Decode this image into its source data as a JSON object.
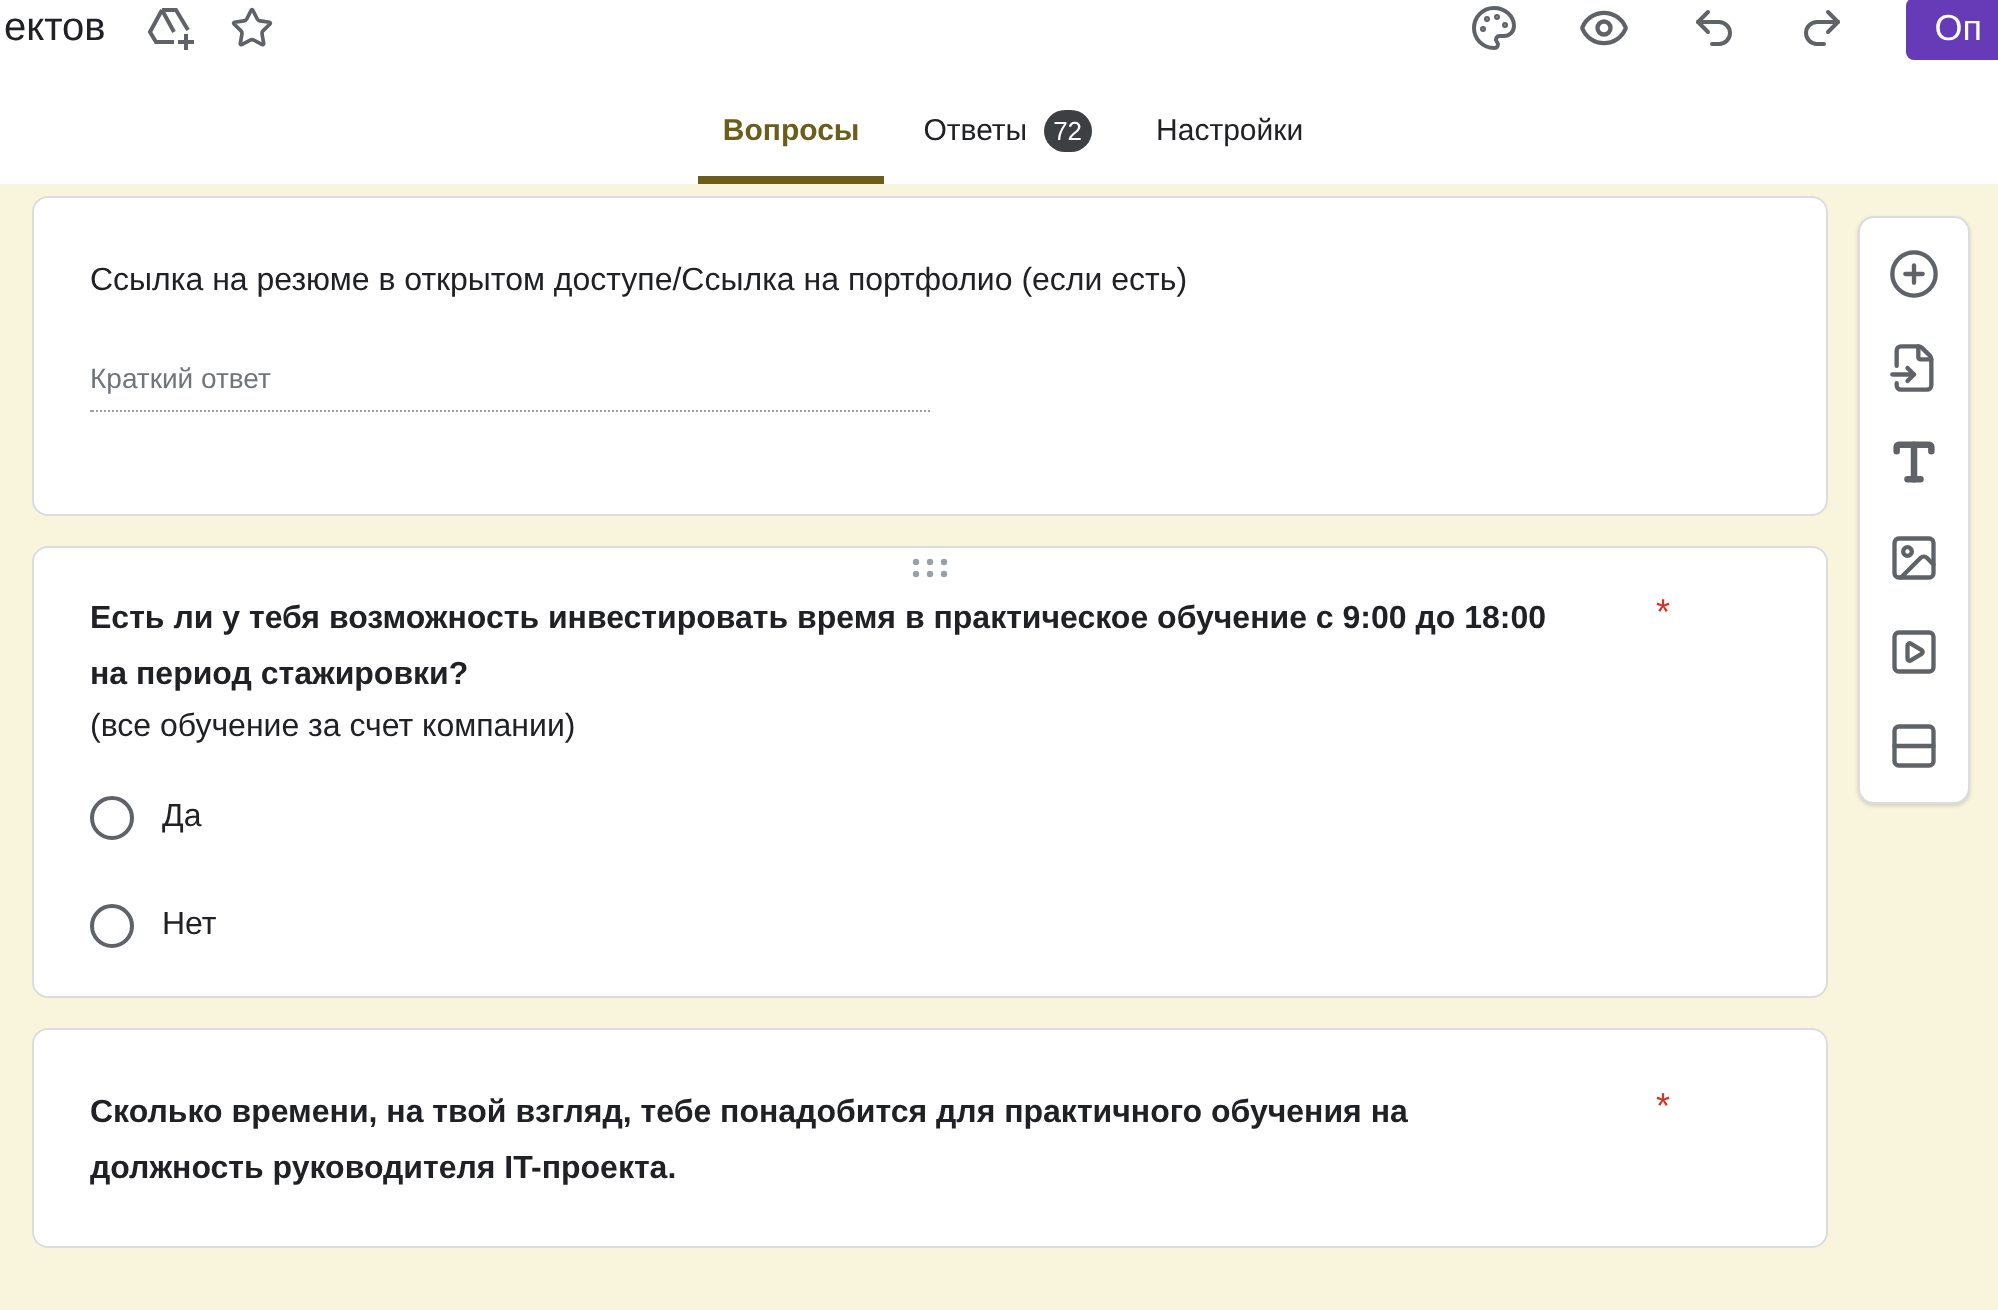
{
  "header": {
    "title": "ектов",
    "action_button": "Оп"
  },
  "required_mark": "*",
  "tabs": [
    {
      "label": "Вопросы",
      "selected": true
    },
    {
      "label": "Ответы",
      "selected": false,
      "badge": "72"
    },
    {
      "label": "Настройки",
      "selected": false
    }
  ],
  "questions": [
    {
      "kind": "short",
      "title": "Ссылка на резюме в открытом доступе/Ссылка на портфолио (если есть)",
      "placeholder": "Краткий ответ",
      "required": false,
      "bold": false,
      "drag_handle": false
    },
    {
      "kind": "radio",
      "title": "Есть ли у тебя возможность инвестировать время в практическое обучение с 9:00 до 18:00 на период стажировки?",
      "description": "(все обучение за счет компании)",
      "required": true,
      "bold": true,
      "drag_handle": true,
      "options": [
        {
          "label": "Да",
          "selected": false
        },
        {
          "label": "Нет",
          "selected": false
        }
      ]
    },
    {
      "kind": "partial",
      "title": "Сколько времени, на твой взгляд, тебе понадобится для практичного обучения на должность руководителя IT-проекта.",
      "required": true,
      "bold": true,
      "drag_handle": false
    }
  ]
}
